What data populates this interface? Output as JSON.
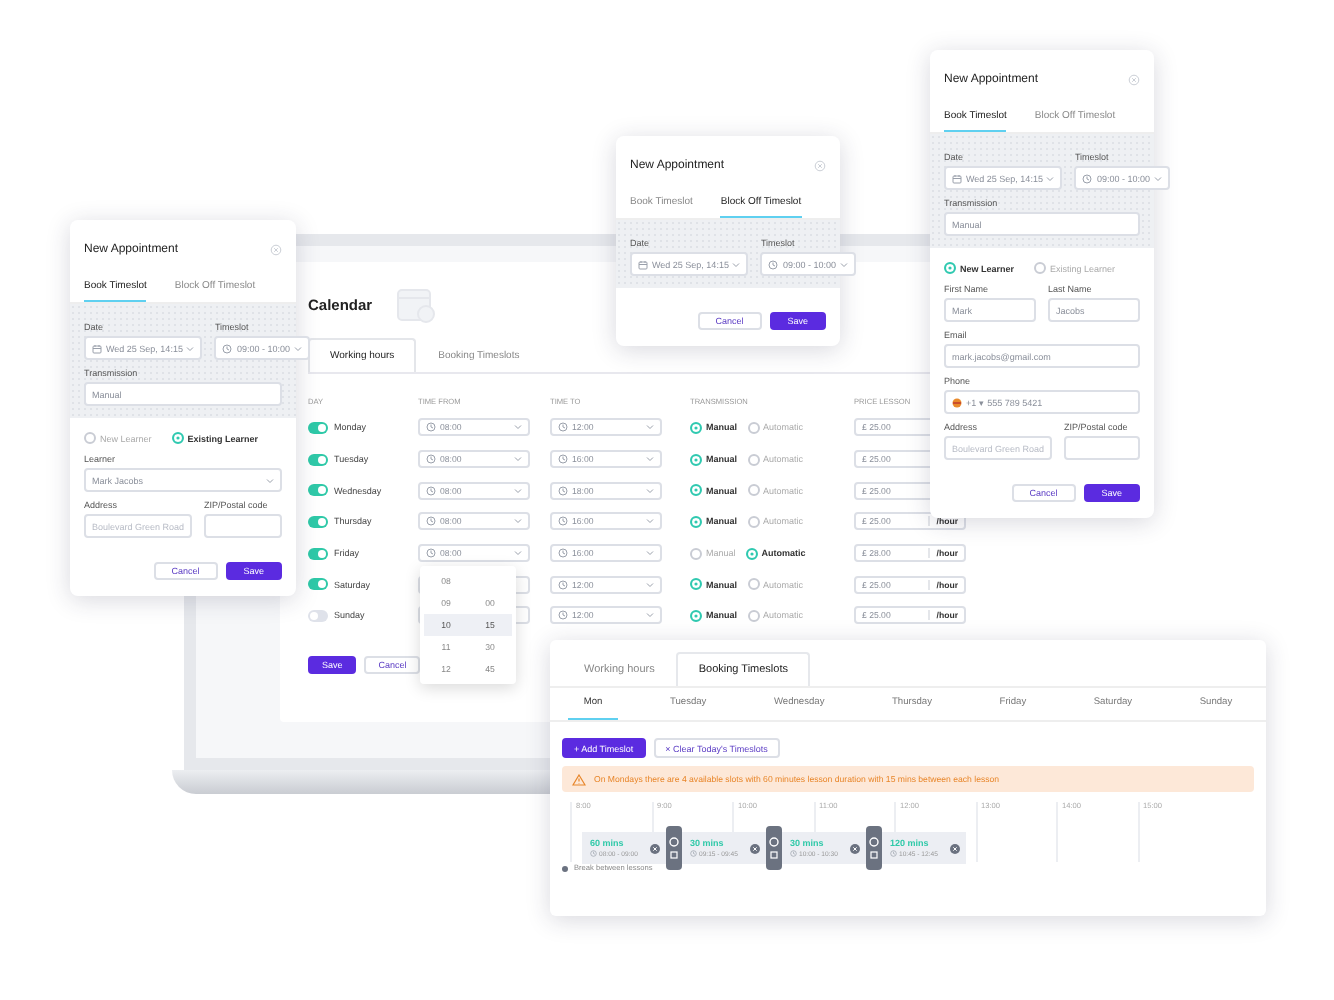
{
  "calendar": {
    "title": "Calendar",
    "tabs": [
      {
        "label": "Working hours",
        "selected": true
      },
      {
        "label": "Booking Timeslots",
        "selected": false
      }
    ],
    "columns": [
      "DAY",
      "TIME FROM",
      "TIME TO",
      "TRANSMISSION",
      "PRICE LESSON"
    ],
    "rows": [
      {
        "day": "Monday",
        "on": true,
        "from": "08:00",
        "to": "12:00",
        "transmission": [
          {
            "label": "Manual",
            "selected": true
          },
          {
            "label": "Automatic",
            "selected": false
          }
        ],
        "currency": "£",
        "price": "25.00"
      },
      {
        "day": "Tuesday",
        "on": true,
        "from": "08:00",
        "to": "16:00",
        "transmission": [
          {
            "label": "Manual",
            "selected": true
          },
          {
            "label": "Automatic",
            "selected": false
          }
        ],
        "currency": "£",
        "price": "25.00"
      },
      {
        "day": "Wednesday",
        "on": true,
        "from": "08:00",
        "to": "18:00",
        "transmission": [
          {
            "label": "Manual",
            "selected": true
          },
          {
            "label": "Automatic",
            "selected": false
          }
        ],
        "currency": "£",
        "price": "25.00"
      },
      {
        "day": "Thursday",
        "on": true,
        "from": "08:00",
        "to": "16:00",
        "transmission": [
          {
            "label": "Manual",
            "selected": true
          },
          {
            "label": "Automatic",
            "selected": false
          }
        ],
        "currency": "£",
        "price": "25.00",
        "unit": "/hour"
      },
      {
        "day": "Friday",
        "on": true,
        "from": "08:00",
        "to": "16:00",
        "transmission": [
          {
            "label": "Manual",
            "selected": false
          },
          {
            "label": "Automatic",
            "selected": true
          }
        ],
        "currency": "£",
        "price": "28.00",
        "unit": "/hour"
      },
      {
        "day": "Saturday",
        "on": true,
        "to": "12:00",
        "transmission": [
          {
            "label": "Manual",
            "selected": true
          },
          {
            "label": "Automatic",
            "selected": false
          }
        ],
        "currency": "£",
        "price": "25.00",
        "unit": "/hour"
      },
      {
        "day": "Sunday",
        "on": false,
        "to": "12:00",
        "transmission": [
          {
            "label": "Manual",
            "selected": true
          },
          {
            "label": "Automatic",
            "selected": false
          }
        ],
        "currency": "£",
        "price": "25.00",
        "unit": "/hour"
      }
    ],
    "time_picker": {
      "hours": [
        {
          "label": "08",
          "selected": false
        },
        {
          "label": "09",
          "selected": false
        },
        {
          "label": "10",
          "selected": true
        },
        {
          "label": "11",
          "selected": false
        },
        {
          "label": "12",
          "selected": false
        }
      ],
      "minutes": [
        {
          "label": "00",
          "selected": false
        },
        {
          "label": "15",
          "selected": true
        },
        {
          "label": "30",
          "selected": false
        },
        {
          "label": "45",
          "selected": false
        }
      ]
    },
    "buttons": [
      {
        "label": "Save",
        "kind": "primary"
      },
      {
        "label": "Cancel",
        "kind": "secondary"
      }
    ]
  },
  "modals": [
    {
      "title": "New Appointment",
      "tabs": [
        {
          "label": "Book Timeslot",
          "selected": true
        },
        {
          "label": "Block Off Timeslot",
          "selected": false
        }
      ],
      "top_rows": [
        [
          {
            "label": "Date",
            "value": "Wed 25 Sep, 14:15",
            "kind": "date"
          },
          {
            "label": "Timeslot",
            "value": "09:00 - 10:00",
            "kind": "time"
          }
        ],
        [
          {
            "label": "Transmission",
            "value": "Manual",
            "kind": "text"
          }
        ]
      ],
      "learner_type": [
        {
          "label": "New Learner",
          "selected": false
        },
        {
          "label": "Existing Learner",
          "selected": true
        }
      ],
      "rows": [
        [
          {
            "label": "Learner",
            "value": "Mark Jacobs",
            "kind": "select"
          }
        ],
        [
          {
            "label": "Address",
            "placeholder": "Boulevard Green Road",
            "kind": "text"
          },
          {
            "label": "ZIP/Postal code",
            "kind": "text"
          }
        ]
      ],
      "buttons": [
        {
          "label": "Cancel",
          "kind": "secondary"
        },
        {
          "label": "Save",
          "kind": "primary"
        }
      ]
    },
    {
      "title": "New Appointment",
      "tabs": [
        {
          "label": "Book Timeslot",
          "selected": false
        },
        {
          "label": "Block Off Timeslot",
          "selected": true
        }
      ],
      "top_rows": [
        [
          {
            "label": "Date",
            "value": "Wed 25 Sep, 14:15",
            "kind": "date"
          },
          {
            "label": "Timeslot",
            "value": "09:00 - 10:00",
            "kind": "time"
          }
        ]
      ],
      "buttons": [
        {
          "label": "Cancel",
          "kind": "secondary"
        },
        {
          "label": "Save",
          "kind": "primary"
        }
      ]
    },
    {
      "title": "New Appointment",
      "tabs": [
        {
          "label": "Book Timeslot",
          "selected": true
        },
        {
          "label": "Block Off Timeslot",
          "selected": false
        }
      ],
      "top_rows": [
        [
          {
            "label": "Date",
            "value": "Wed 25 Sep, 14:15",
            "kind": "date"
          },
          {
            "label": "Timeslot",
            "value": "09:00 - 10:00",
            "kind": "time"
          }
        ],
        [
          {
            "label": "Transmission",
            "value": "Manual",
            "kind": "text"
          }
        ]
      ],
      "learner_type": [
        {
          "label": "New Learner",
          "selected": true
        },
        {
          "label": "Existing Learner",
          "selected": false
        }
      ],
      "rows": [
        [
          {
            "label": "First Name",
            "value": "Mark",
            "kind": "text"
          },
          {
            "label": "Last Name",
            "value": "Jacobs",
            "kind": "text"
          }
        ],
        [
          {
            "label": "Email",
            "value": "mark.jacobs@gmail.com",
            "kind": "text"
          }
        ],
        [
          {
            "label": "Phone",
            "value": "+1 ▾ 555 789 5421",
            "kind": "phone"
          }
        ],
        [
          {
            "label": "Address",
            "placeholder": "Boulevard Green Road",
            "kind": "text"
          },
          {
            "label": "ZIP/Postal code",
            "kind": "text"
          }
        ]
      ],
      "buttons": [
        {
          "label": "Cancel",
          "kind": "secondary"
        },
        {
          "label": "Save",
          "kind": "primary"
        }
      ]
    }
  ],
  "timeslots": {
    "tabs": [
      {
        "label": "Working hours",
        "selected": false
      },
      {
        "label": "Booking Timeslots",
        "selected": true
      }
    ],
    "days": [
      {
        "label": "Mon",
        "selected": true
      },
      {
        "label": "Tuesday",
        "selected": false
      },
      {
        "label": "Wednesday",
        "selected": false
      },
      {
        "label": "Thursday",
        "selected": false
      },
      {
        "label": "Friday",
        "selected": false
      },
      {
        "label": "Saturday",
        "selected": false
      },
      {
        "label": "Sunday",
        "selected": false
      }
    ],
    "actions": [
      {
        "label": "+ Add Timeslot",
        "kind": "primary"
      },
      {
        "label": "× Clear Today's Timeslots",
        "kind": "secondary"
      }
    ],
    "warning": "On Mondays there are 4 available slots with 60 minutes lesson duration with 15 mins between each lesson",
    "ticks": [
      "8:00",
      "9:00",
      "10:00",
      "11:00",
      "12:00",
      "13:00",
      "14:00",
      "15:00"
    ],
    "slots": [
      {
        "duration": "60 mins",
        "time": "08:00 - 09:00"
      },
      {
        "duration": "30 mins",
        "time": "09:15 - 09:45"
      },
      {
        "duration": "30 mins",
        "time": "10:00 - 10:30"
      },
      {
        "duration": "120 mins",
        "time": "10:45 - 12:45"
      }
    ],
    "legend": "Break between lessons"
  }
}
